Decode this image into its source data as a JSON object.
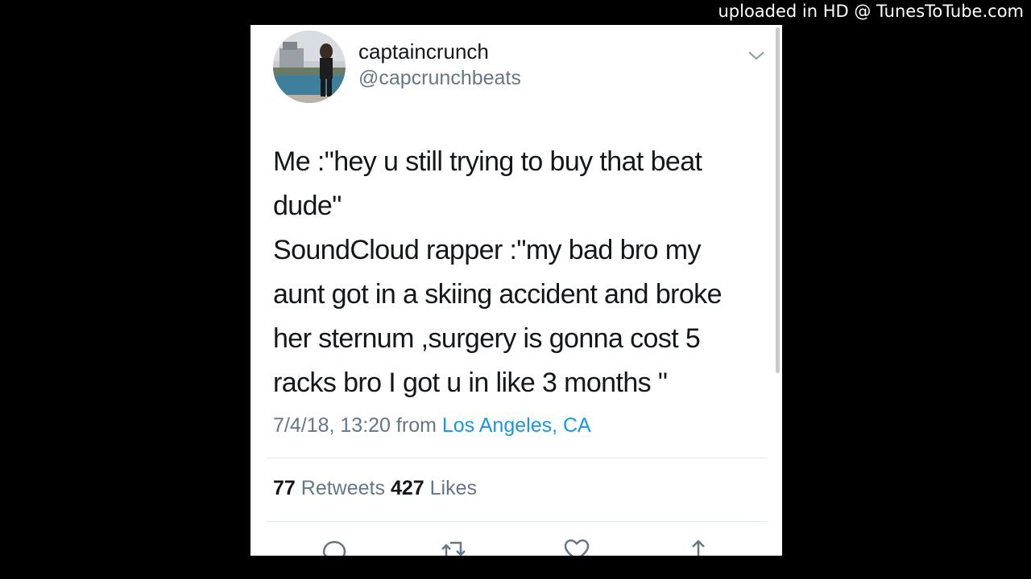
{
  "watermark": "uploaded in HD @ TunesToTube.com",
  "tweet": {
    "display_name": "captaincrunch",
    "handle": "@capcrunchbeats",
    "text": "Me :\"hey u still trying to buy that beat\ndude\"\nSoundCloud rapper :\"my bad bro my\naunt got in a skiing accident and broke\nher sternum ,surgery is gonna cost 5\nracks bro I got u in like 3 months \"",
    "timestamp": "7/4/18, 13:20",
    "from_label": "from",
    "location": "Los Angeles, CA",
    "retweets_count": "77",
    "retweets_label": "Retweets",
    "likes_count": "427",
    "likes_label": "Likes"
  },
  "actions": [
    {
      "icon": "reply-icon"
    },
    {
      "icon": "retweet-icon"
    },
    {
      "icon": "like-icon"
    },
    {
      "icon": "share-icon"
    }
  ],
  "colors": {
    "background": "#000000",
    "card": "#ffffff",
    "text": "#14171a",
    "muted": "#657786",
    "link": "#1b95e0"
  }
}
